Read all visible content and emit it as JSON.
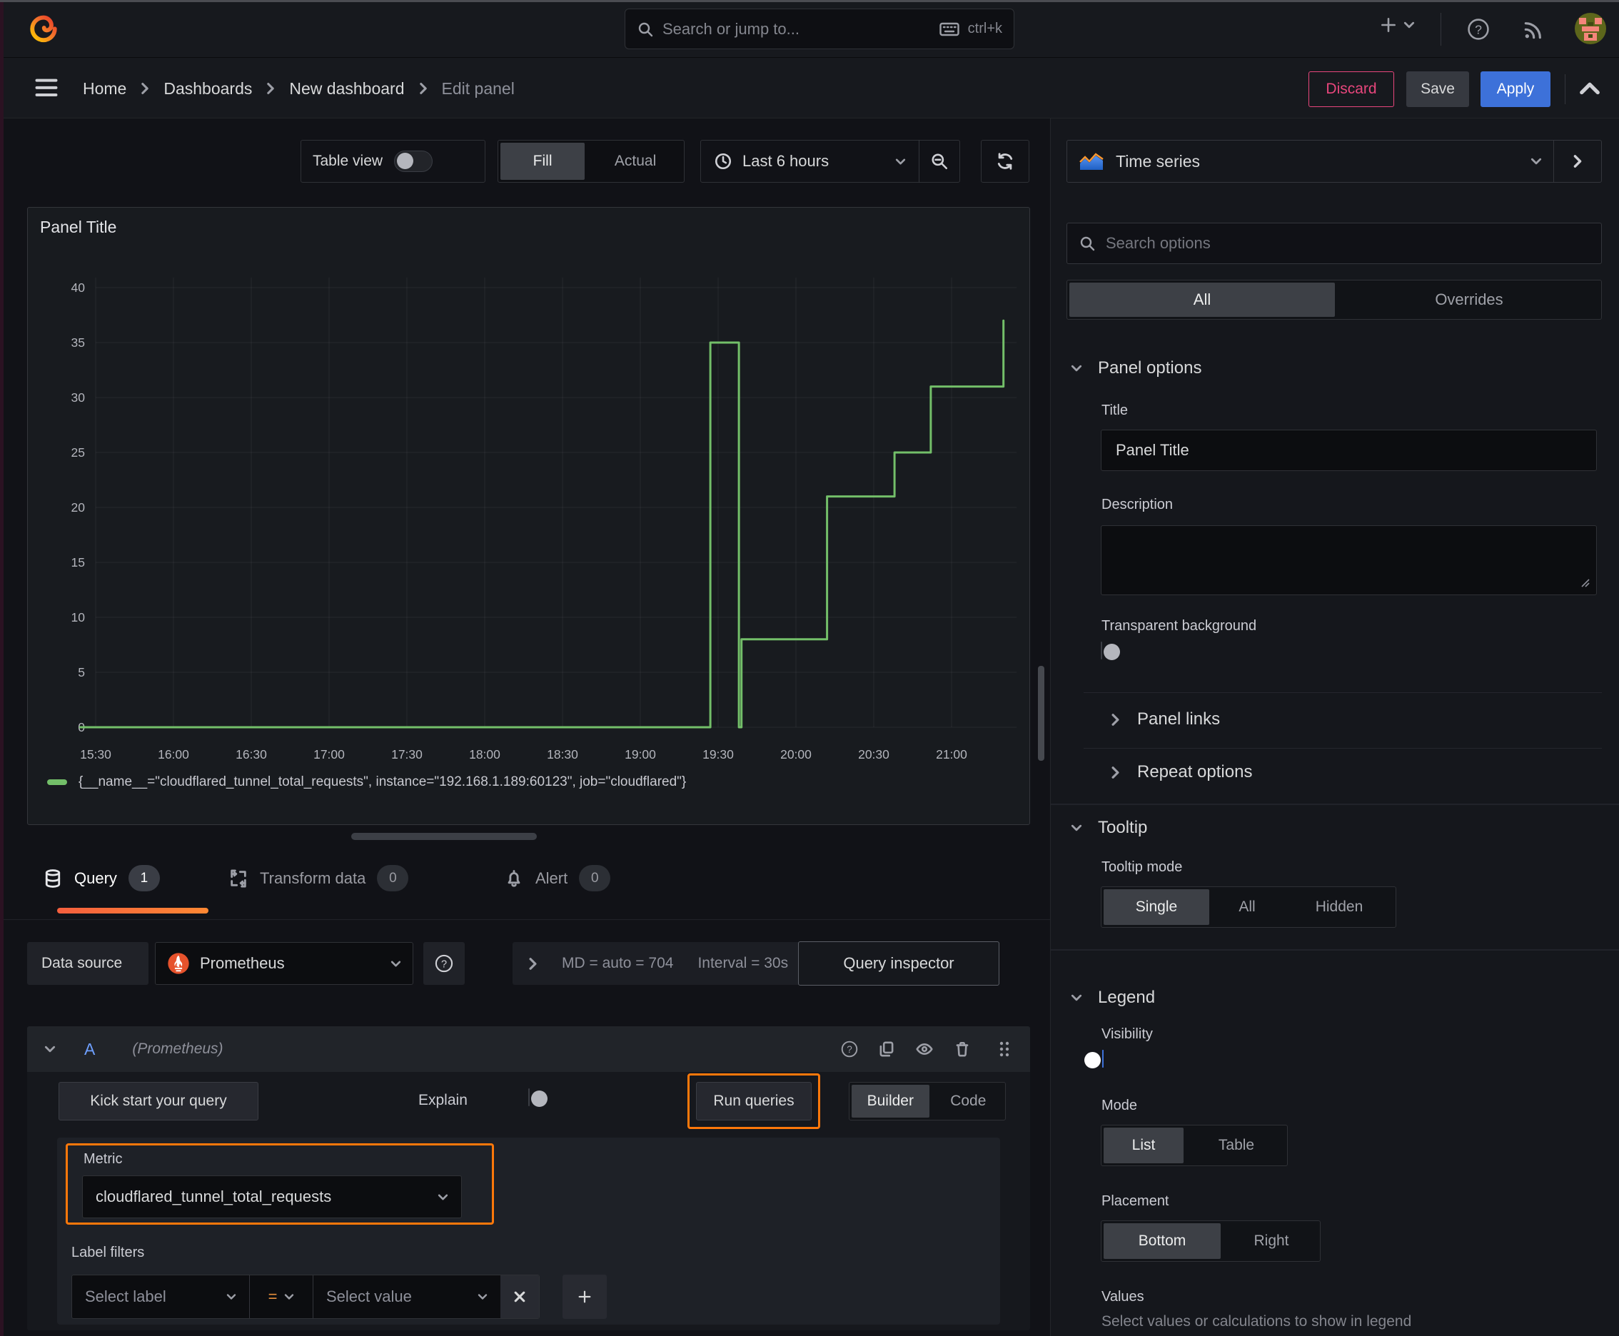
{
  "topbar": {
    "search_placeholder": "Search or jump to...",
    "shortcut": "ctrl+k"
  },
  "breadcrumb": {
    "items": [
      {
        "label": "Home"
      },
      {
        "label": "Dashboards"
      },
      {
        "label": "New dashboard"
      },
      {
        "label": "Edit panel"
      }
    ]
  },
  "actions": {
    "discard": "Discard",
    "save": "Save",
    "apply": "Apply"
  },
  "toolbar": {
    "table_view": "Table view",
    "fill": "Fill",
    "actual": "Actual",
    "time_range": "Last 6 hours"
  },
  "panel": {
    "title": "Panel Title"
  },
  "chart_data": {
    "type": "line",
    "title": "Panel Title",
    "x_ticks": [
      "15:30",
      "16:00",
      "16:30",
      "17:00",
      "17:30",
      "18:00",
      "18:30",
      "19:00",
      "19:30",
      "20:00",
      "20:30",
      "21:00"
    ],
    "y_ticks": [
      0,
      5,
      10,
      15,
      20,
      25,
      30,
      35,
      40
    ],
    "ylim": [
      0,
      40
    ],
    "grid": true,
    "legend_position": "bottom",
    "series": [
      {
        "name": "{__name__=\"cloudflared_tunnel_total_requests\", instance=\"192.168.1.189:60123\", job=\"cloudflared\"}",
        "color": "#73bf69",
        "points": [
          [
            "15:24",
            0
          ],
          [
            "19:27",
            0
          ],
          [
            "19:27",
            35
          ],
          [
            "19:38",
            35
          ],
          [
            "19:38",
            0
          ],
          [
            "19:39",
            0
          ],
          [
            "19:39",
            8
          ],
          [
            "20:12",
            8
          ],
          [
            "20:12",
            21
          ],
          [
            "20:38",
            21
          ],
          [
            "20:38",
            25
          ],
          [
            "20:52",
            25
          ],
          [
            "20:52",
            31
          ],
          [
            "21:20",
            31
          ],
          [
            "21:20",
            37
          ]
        ]
      }
    ]
  },
  "tabs": {
    "query": "Query",
    "query_count": "1",
    "transform": "Transform data",
    "transform_count": "0",
    "alert": "Alert",
    "alert_count": "0"
  },
  "datasource_row": {
    "label": "Data source",
    "name": "Prometheus",
    "stats_md": "MD = auto = 704",
    "stats_interval": "Interval = 30s",
    "inspector": "Query inspector"
  },
  "query": {
    "ref": "A",
    "ds_hint": "(Prometheus)",
    "kickstart": "Kick start your query",
    "explain": "Explain",
    "run": "Run queries",
    "builder": "Builder",
    "code": "Code",
    "metric_label": "Metric",
    "metric_value": "cloudflared_tunnel_total_requests",
    "label_filters": "Label filters",
    "select_label": "Select label",
    "operator": "=",
    "select_value": "Select value"
  },
  "options": {
    "viz_type": "Time series",
    "search_placeholder": "Search options",
    "tab_all": "All",
    "tab_overrides": "Overrides",
    "panel_options": "Panel options",
    "title_label": "Title",
    "title_value": "Panel Title",
    "description_label": "Description",
    "transparent_label": "Transparent background",
    "panel_links": "Panel links",
    "repeat_options": "Repeat options",
    "tooltip": "Tooltip",
    "tooltip_mode": "Tooltip mode",
    "mode_single": "Single",
    "mode_all": "All",
    "mode_hidden": "Hidden",
    "legend": "Legend",
    "visibility": "Visibility",
    "mode": "Mode",
    "mode_list": "List",
    "mode_table": "Table",
    "placement": "Placement",
    "placement_bottom": "Bottom",
    "placement_right": "Right",
    "values": "Values",
    "values_hint": "Select values or calculations to show in legend"
  }
}
